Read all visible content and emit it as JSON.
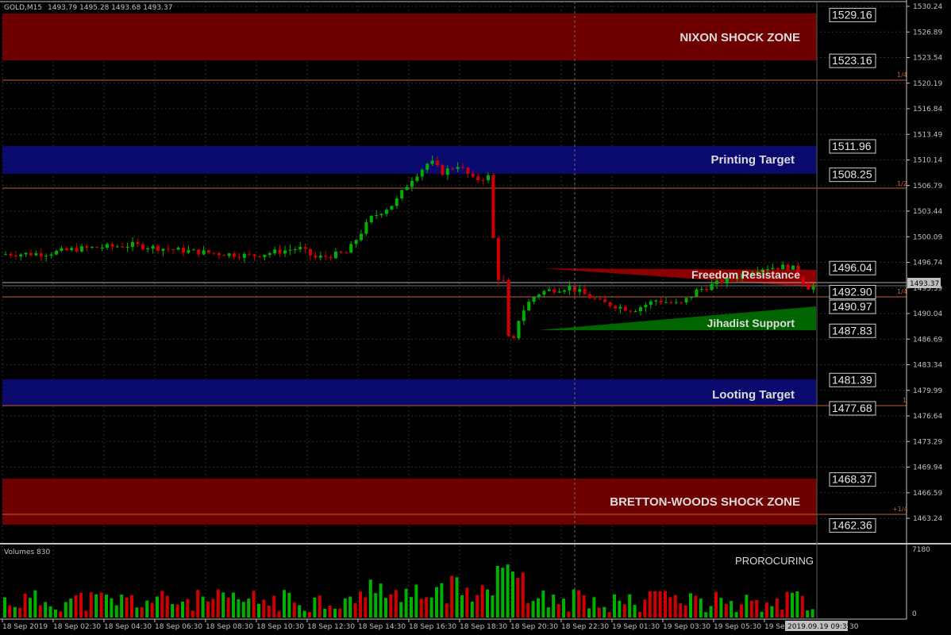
{
  "header": {
    "symbol": "GOLD,M15",
    "ohlc": "1493.79 1495.28 1493.68 1493.37"
  },
  "current_price": "1493.37",
  "current_time_label": "2019.09.19 09:35",
  "y_axis": {
    "ticks": [
      "1530.24",
      "1526.89",
      "1523.54",
      "1520.19",
      "1516.84",
      "1513.49",
      "1510.14",
      "1506.79",
      "1503.44",
      "1500.09",
      "1496.74",
      "1493.39",
      "1490.04",
      "1486.69",
      "1483.34",
      "1479.99",
      "1476.64",
      "1473.29",
      "1469.94",
      "1466.59",
      "1463.24"
    ]
  },
  "x_axis": {
    "ticks": [
      "18 Sep 2019",
      "18 Sep 02:30",
      "18 Sep 04:30",
      "18 Sep 06:30",
      "18 Sep 08:30",
      "18 Sep 10:30",
      "18 Sep 12:30",
      "18 Sep 14:30",
      "18 Sep 16:30",
      "18 Sep 18:30",
      "18 Sep 20:30",
      "18 Sep 22:30",
      "19 Sep 01:30",
      "19 Sep 03:30",
      "19 Sep 05:30",
      "19 Sep"
    ],
    "tail_label": "30"
  },
  "zones": [
    {
      "label": "NIXON SHOCK ZONE",
      "top": "1529.16",
      "bottom": "1523.16",
      "color": "#6e0000"
    },
    {
      "label": "Printing Target",
      "top": "1511.96",
      "bottom": "1508.25",
      "color": "#0a0a6e"
    },
    {
      "label": "Looting Target",
      "top": "1481.39",
      "bottom": "1477.68",
      "color": "#0a0a6e"
    },
    {
      "label": "BRETTON-WOODS SHOCK ZONE",
      "top": "1468.37",
      "bottom": "1462.36",
      "color": "#6e0000"
    }
  ],
  "wedge_labels": {
    "resistance": "Freedom Resistance",
    "support": "Jihadist Support"
  },
  "price_boxes": [
    "1529.16",
    "1523.16",
    "1511.96",
    "1508.25",
    "1496.04",
    "1492.90",
    "1490.97",
    "1487.83",
    "1481.39",
    "1477.68",
    "1468.37",
    "1462.36"
  ],
  "fib_labels": [
    "1/4",
    "1/2",
    "1/4",
    "1",
    "+1/4"
  ],
  "volumes": {
    "title": "Volumes 830",
    "indicator": "PROROCURING",
    "max": "7180",
    "min": "0"
  },
  "colors": {
    "bull": "#00b000",
    "bear": "#d00000",
    "grid": "#3a3a3a",
    "fib": "#c06030",
    "support": "#006400",
    "resistance": "#8b0000"
  }
}
